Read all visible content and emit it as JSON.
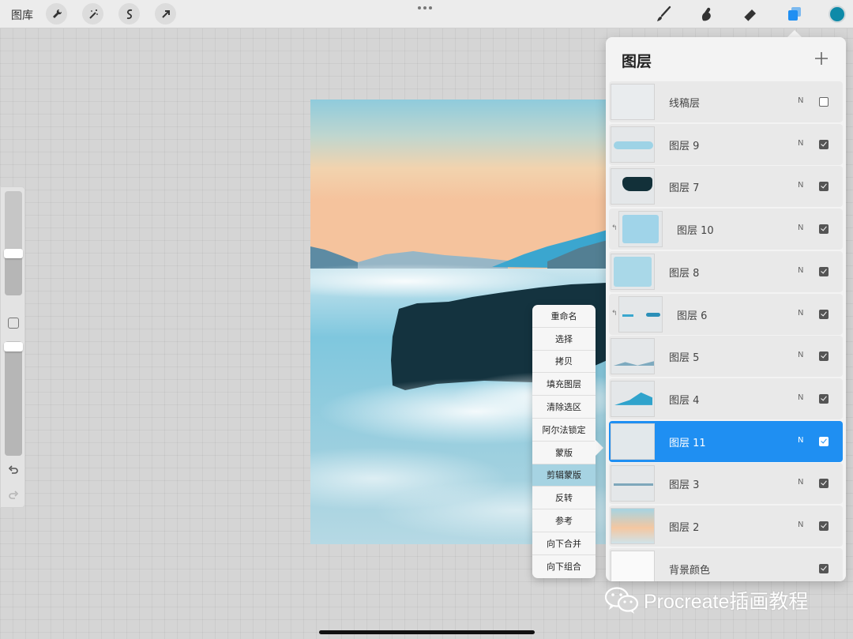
{
  "toolbar": {
    "gallery_label": "图库",
    "left_tools": [
      "wrench-icon",
      "magic-wand-icon",
      "selection-icon",
      "transform-icon"
    ],
    "right_tools": [
      "brush-icon",
      "smudge-icon",
      "eraser-icon",
      "layers-icon"
    ],
    "active_tool": "layers-icon",
    "current_color": "#0e8aa8"
  },
  "sidebar": {
    "brush_size_level": 0.4,
    "opacity_level": 0.95
  },
  "layers_panel": {
    "title": "图层",
    "accent_color": "#1f8ff2",
    "layers": [
      {
        "name": "线稿层",
        "blend": "N",
        "visible": false
      },
      {
        "name": "图层 9",
        "blend": "N",
        "visible": true
      },
      {
        "name": "图层 7",
        "blend": "N",
        "visible": true
      },
      {
        "name": "图层 10",
        "blend": "N",
        "visible": true,
        "clipped": true
      },
      {
        "name": "图层 8",
        "blend": "N",
        "visible": true
      },
      {
        "name": "图层 6",
        "blend": "N",
        "visible": true,
        "clipped": true
      },
      {
        "name": "图层 5",
        "blend": "N",
        "visible": true
      },
      {
        "name": "图层 4",
        "blend": "N",
        "visible": true
      },
      {
        "name": "图层 11",
        "blend": "N",
        "visible": true,
        "selected": true
      },
      {
        "name": "图层 3",
        "blend": "N",
        "visible": true
      },
      {
        "name": "图层 2",
        "blend": "N",
        "visible": true
      },
      {
        "name": "背景颜色",
        "blend": "",
        "visible": true
      }
    ]
  },
  "layer_menu": {
    "items": [
      "重命名",
      "选择",
      "拷贝",
      "填充图层",
      "清除选区",
      "阿尔法锁定",
      "蒙版",
      "剪辑蒙版",
      "反转",
      "参考",
      "向下合并",
      "向下组合"
    ],
    "highlighted": "剪辑蒙版"
  },
  "watermark": {
    "text": "Procreate插画教程"
  }
}
